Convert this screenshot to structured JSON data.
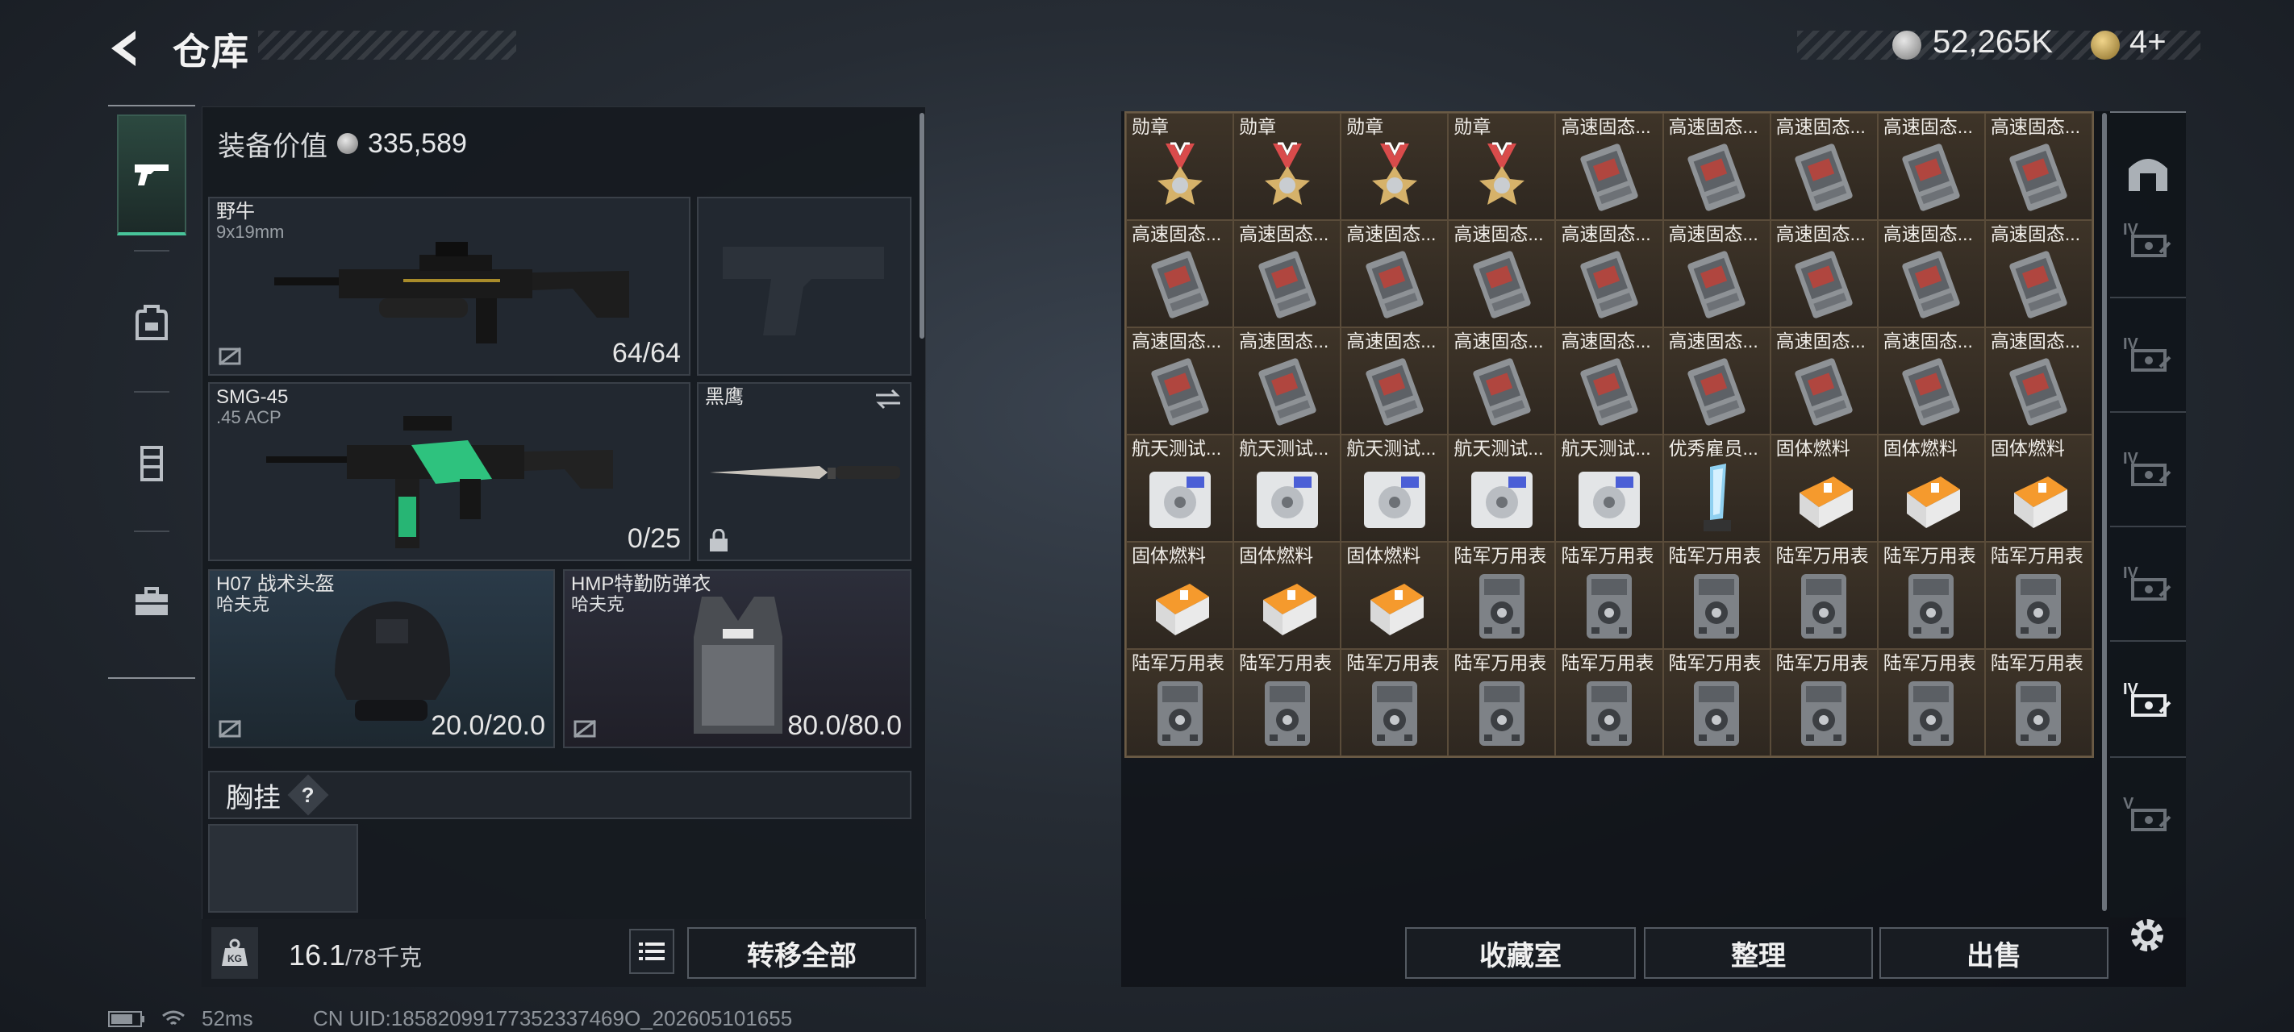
{
  "header": {
    "title": "仓库",
    "money": "52,265K",
    "tokens": "4+",
    "back_icon": "chevron-left-icon"
  },
  "equipment": {
    "value_label": "装备价值",
    "value": "335,589",
    "primary": {
      "name": "野牛",
      "ammo": "9x19mm",
      "durability": "64/64"
    },
    "secondary": {
      "name": "SMG-45",
      "ammo": ".45 ACP",
      "durability": "0/25"
    },
    "melee": {
      "name": "黑鹰"
    },
    "helmet": {
      "name": "H07 战术头盔",
      "brand": "哈夫克",
      "durability": "20.0/20.0"
    },
    "armor": {
      "name": "HMP特勤防弹衣",
      "brand": "哈夫克",
      "durability": "80.0/80.0"
    },
    "chest_rig": {
      "label": "胸挂",
      "help": "?"
    }
  },
  "footer": {
    "weight": "16.1",
    "weight_cap": "/78千克",
    "kg": "KG",
    "transfer_all": "转移全部"
  },
  "storage": {
    "cells": [
      {
        "label": "勋章",
        "icon": "medal"
      },
      {
        "label": "勋章",
        "icon": "medal"
      },
      {
        "label": "勋章",
        "icon": "medal"
      },
      {
        "label": "勋章",
        "icon": "medal"
      },
      {
        "label": "高速固态...",
        "icon": "ssd"
      },
      {
        "label": "高速固态...",
        "icon": "ssd"
      },
      {
        "label": "高速固态...",
        "icon": "ssd"
      },
      {
        "label": "高速固态...",
        "icon": "ssd"
      },
      {
        "label": "高速固态...",
        "icon": "ssd"
      },
      {
        "label": "高速固态...",
        "icon": "ssd"
      },
      {
        "label": "高速固态...",
        "icon": "ssd"
      },
      {
        "label": "高速固态...",
        "icon": "ssd"
      },
      {
        "label": "高速固态...",
        "icon": "ssd"
      },
      {
        "label": "高速固态...",
        "icon": "ssd"
      },
      {
        "label": "高速固态...",
        "icon": "ssd"
      },
      {
        "label": "高速固态...",
        "icon": "ssd"
      },
      {
        "label": "高速固态...",
        "icon": "ssd"
      },
      {
        "label": "高速固态...",
        "icon": "ssd"
      },
      {
        "label": "高速固态...",
        "icon": "ssd"
      },
      {
        "label": "高速固态...",
        "icon": "ssd"
      },
      {
        "label": "高速固态...",
        "icon": "ssd"
      },
      {
        "label": "高速固态...",
        "icon": "ssd"
      },
      {
        "label": "高速固态...",
        "icon": "ssd"
      },
      {
        "label": "高速固态...",
        "icon": "ssd"
      },
      {
        "label": "高速固态...",
        "icon": "ssd"
      },
      {
        "label": "高速固态...",
        "icon": "ssd"
      },
      {
        "label": "高速固态...",
        "icon": "ssd"
      },
      {
        "label": "航天测试...",
        "icon": "drive"
      },
      {
        "label": "航天测试...",
        "icon": "drive"
      },
      {
        "label": "航天测试...",
        "icon": "drive"
      },
      {
        "label": "航天测试...",
        "icon": "drive"
      },
      {
        "label": "航天测试...",
        "icon": "drive"
      },
      {
        "label": "优秀雇员...",
        "icon": "trophy"
      },
      {
        "label": "固体燃料",
        "icon": "fuel"
      },
      {
        "label": "固体燃料",
        "icon": "fuel"
      },
      {
        "label": "固体燃料",
        "icon": "fuel"
      },
      {
        "label": "固体燃料",
        "icon": "fuel"
      },
      {
        "label": "固体燃料",
        "icon": "fuel"
      },
      {
        "label": "固体燃料",
        "icon": "fuel"
      },
      {
        "label": "陆军万用表",
        "icon": "meter"
      },
      {
        "label": "陆军万用表",
        "icon": "meter"
      },
      {
        "label": "陆军万用表",
        "icon": "meter"
      },
      {
        "label": "陆军万用表",
        "icon": "meter"
      },
      {
        "label": "陆军万用表",
        "icon": "meter"
      },
      {
        "label": "陆军万用表",
        "icon": "meter"
      },
      {
        "label": "陆军万用表",
        "icon": "meter"
      },
      {
        "label": "陆军万用表",
        "icon": "meter"
      },
      {
        "label": "陆军万用表",
        "icon": "meter"
      },
      {
        "label": "陆军万用表",
        "icon": "meter"
      },
      {
        "label": "陆军万用表",
        "icon": "meter"
      },
      {
        "label": "陆军万用表",
        "icon": "meter"
      },
      {
        "label": "陆军万用表",
        "icon": "meter"
      },
      {
        "label": "陆军万用表",
        "icon": "meter"
      },
      {
        "label": "陆军万用表",
        "icon": "meter"
      }
    ],
    "buttons": {
      "collection": "收藏室",
      "sort": "整理",
      "sell": "出售"
    }
  },
  "rail": {
    "tab_labels": [
      "IV",
      "IV",
      "IV",
      "IV",
      "IV",
      "V"
    ]
  },
  "status": {
    "ping": "52ms",
    "uid": "CN UID:18582099177352337469O_202605101655"
  }
}
